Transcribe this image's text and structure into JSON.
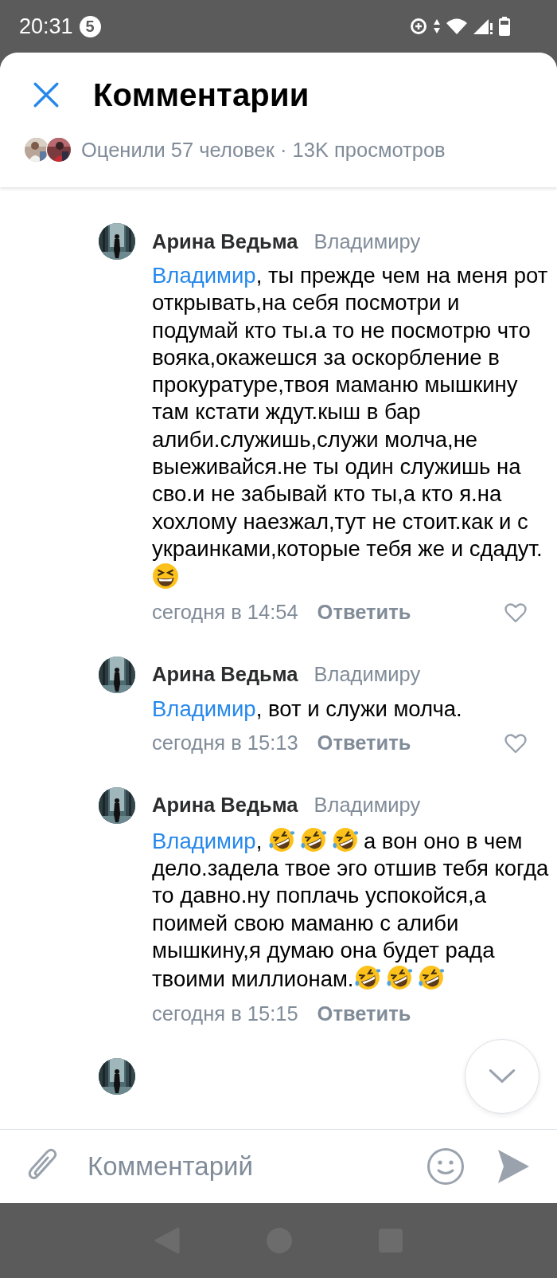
{
  "status_bar": {
    "time": "20:31",
    "notification_badge": "5"
  },
  "header": {
    "title": "Комментарии",
    "summary": "Оценили 57 человек · 13K просмотров"
  },
  "comments": [
    {
      "author": "Арина Ведьма",
      "reply_to": "Владимиру",
      "body": [
        {
          "kind": "mention",
          "text": "Владимир"
        },
        {
          "kind": "text",
          "text": ", ты прежде чем на меня рот открывать,на себя посмотри и подумай кто ты.а то не посмотрю что вояка,окажешся за оскорбление в прокуратуре,твоя маманю мышкину там кстати ждут.кыш в бар алиби.служишь,служи молча,не выеживайся.не ты один служишь на сво.и не забывай кто ты,а кто я.на хохлому наезжал,тут не стоит.как и с украинками,которые тебя же и сдадут."
        },
        {
          "kind": "grin"
        }
      ],
      "time": "сегодня в 14:54",
      "reply_label": "Ответить",
      "like_button": true
    },
    {
      "author": "Арина Ведьма",
      "reply_to": "Владимиру",
      "body": [
        {
          "kind": "mention",
          "text": "Владимир"
        },
        {
          "kind": "text",
          "text": ", вот и служи молча."
        }
      ],
      "time": "сегодня в 15:13",
      "reply_label": "Ответить",
      "like_button": true
    },
    {
      "author": "Арина Ведьма",
      "reply_to": "Владимиру",
      "body": [
        {
          "kind": "mention",
          "text": "Владимир"
        },
        {
          "kind": "text",
          "text": ", "
        },
        {
          "kind": "rofl"
        },
        {
          "kind": "rofl"
        },
        {
          "kind": "rofl"
        },
        {
          "kind": "text",
          "text": "а вон оно в чем дело.задела твое эго отшив тебя когда то давно.ну поплачь успокойся,а поимей свою маманю с алиби мышкину,я думаю она будет рада твоими миллионам."
        },
        {
          "kind": "rofl"
        },
        {
          "kind": "rofl"
        },
        {
          "kind": "rofl"
        }
      ],
      "time": "сегодня в 15:15",
      "reply_label": "Ответить",
      "like_button": false
    }
  ],
  "composer": {
    "placeholder": "Комментарий"
  }
}
